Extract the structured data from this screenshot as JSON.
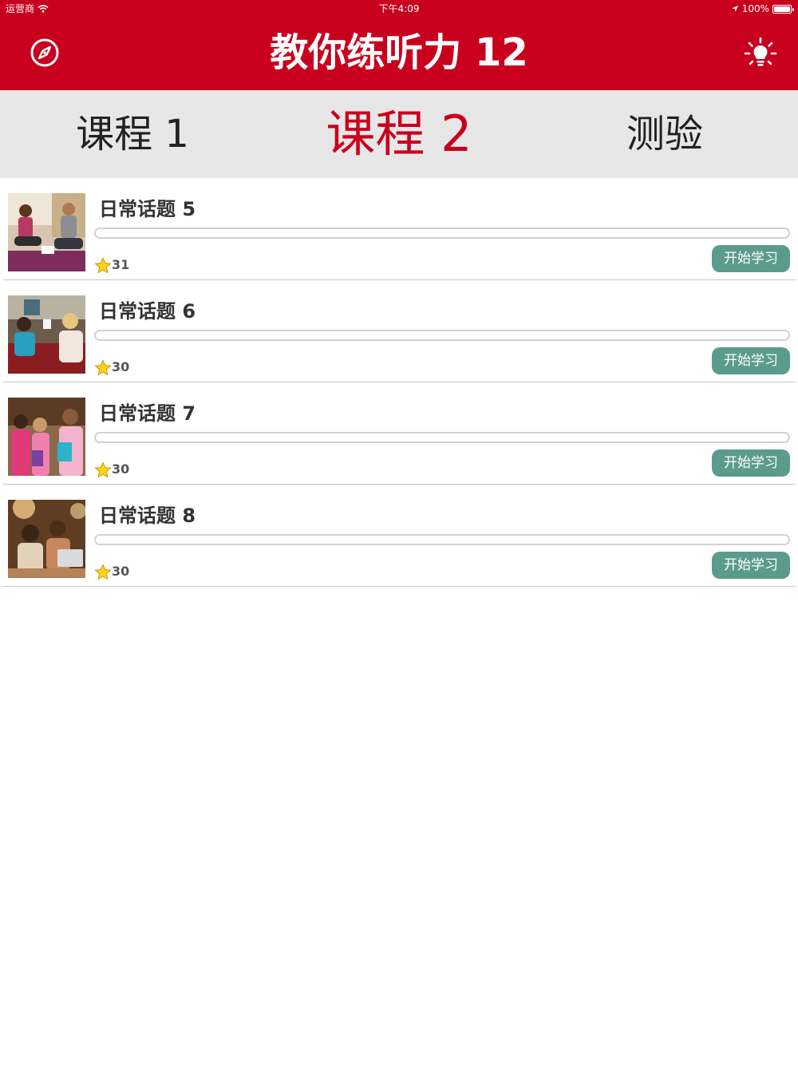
{
  "status_bar": {
    "carrier": "运营商",
    "time": "下午4:09",
    "battery": "100%"
  },
  "header": {
    "title": "教你练听力 12",
    "left_icon": "compass-icon",
    "right_icon": "lightbulb-icon",
    "background_color": "#c8001e"
  },
  "tabs": [
    {
      "label": "课程 1",
      "active": false
    },
    {
      "label": "课程 2",
      "active": true
    },
    {
      "label": "测验",
      "active": false
    }
  ],
  "lessons": [
    {
      "title": "日常话题 5",
      "stars": "31",
      "button": "开始学习",
      "progress": 0,
      "image": "photo-people-on-floor"
    },
    {
      "title": "日常话题 6",
      "stars": "30",
      "button": "开始学习",
      "progress": 0,
      "image": "photo-women-chatting"
    },
    {
      "title": "日常话题 7",
      "stars": "30",
      "button": "开始学习",
      "progress": 0,
      "image": "photo-students-group"
    },
    {
      "title": "日常话题 8",
      "stars": "30",
      "button": "开始学习",
      "progress": 0,
      "image": "photo-friends-laptop"
    }
  ],
  "colors": {
    "accent": "#c8001e",
    "button": "#5b9b8c",
    "tab_background": "#e7e7e7"
  }
}
